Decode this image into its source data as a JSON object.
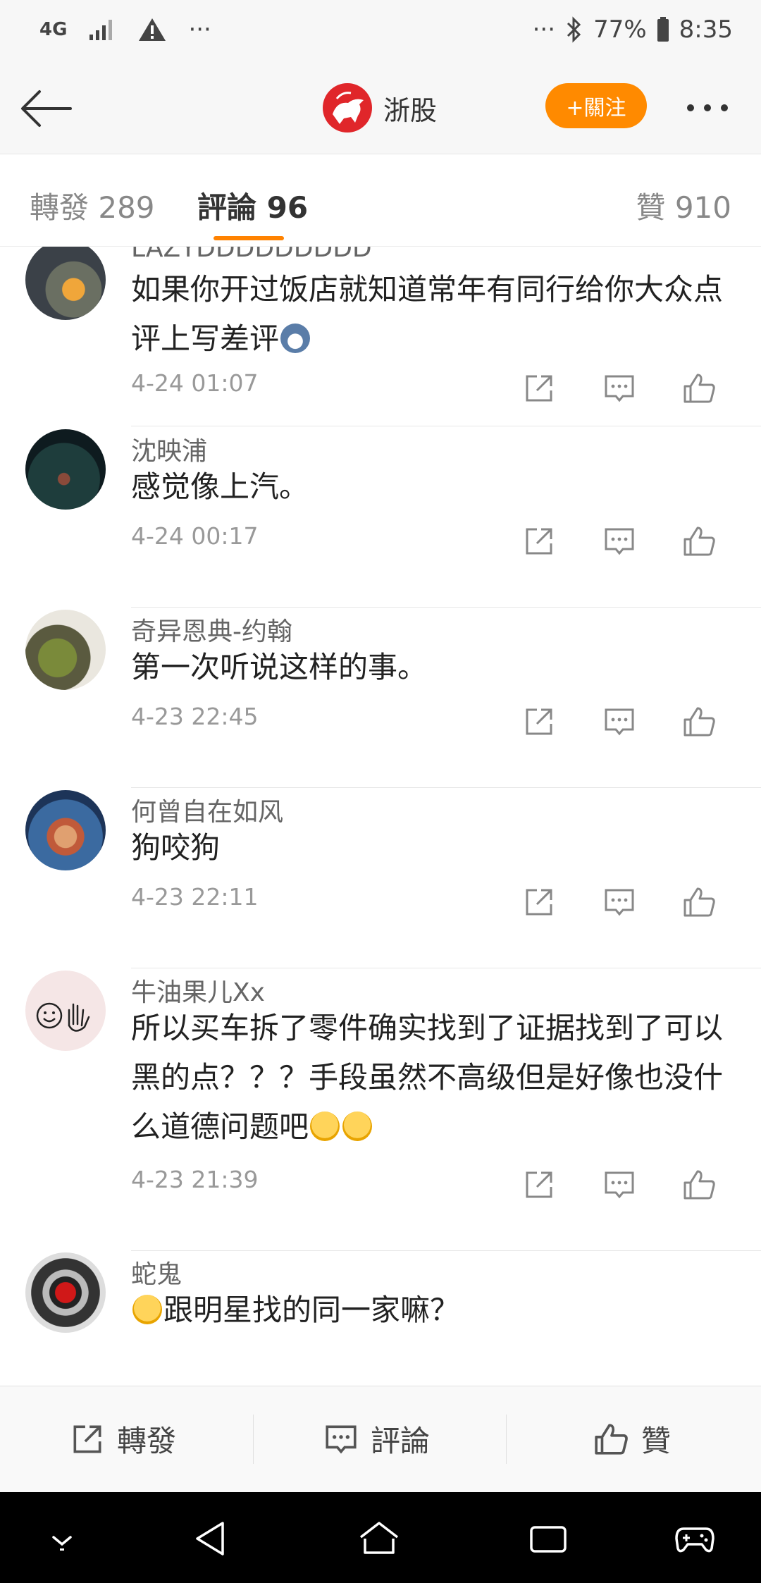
{
  "status_bar": {
    "network": "4G",
    "left_extra": "···",
    "right_extra": "···",
    "battery": "77%",
    "time": "8:35"
  },
  "header": {
    "account_name": "浙股",
    "follow_label": "+關注"
  },
  "tabs": [
    {
      "label": "轉發 289"
    },
    {
      "label": "評論 96"
    },
    {
      "label": "贊 910"
    }
  ],
  "comments": [
    {
      "username": "LAZYDDDDDDDDD",
      "text": "如果你开过饭店就知道常年有同行给你大众点评上写差评",
      "time": "4-24 01:07"
    },
    {
      "username": "沈映浦",
      "text": "感觉像上汽。",
      "time": "4-24 00:17"
    },
    {
      "username": "奇异恩典-约翰",
      "text": "第一次听说这样的事。",
      "time": "4-23 22:45"
    },
    {
      "username": "何曾自在如风",
      "text": "狗咬狗",
      "time": "4-23 22:11"
    },
    {
      "username": "牛油果儿Xx",
      "text": "所以买车拆了零件确实找到了证据找到了可以黑的点？？？手段虽然不高级但是好像也没什么道德问题吧",
      "time": "4-23 21:39"
    },
    {
      "username": "蛇鬼",
      "text": "跟明星找的同一家嘛？",
      "time": ""
    }
  ],
  "bottom_bar": {
    "repost_label": "轉發",
    "comment_label": "評論",
    "like_label": "贊"
  },
  "colors": {
    "accent": "#ff8200",
    "follow_button": "#ff8a00",
    "brand_logo": "#e0262a"
  }
}
